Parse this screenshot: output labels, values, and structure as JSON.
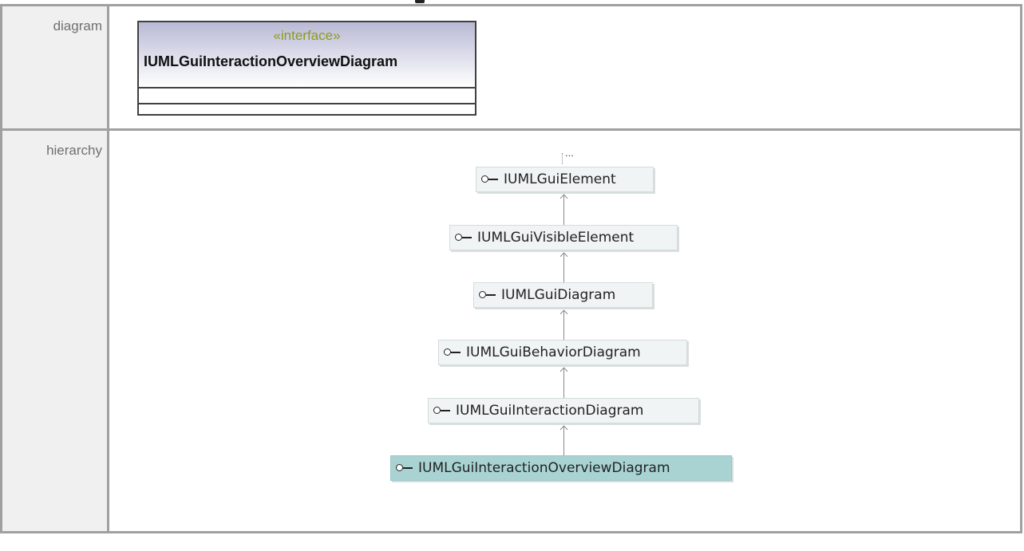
{
  "rows": {
    "diagram_label": "diagram",
    "hierarchy_label": "hierarchy"
  },
  "uml_class": {
    "stereotype": "«interface»",
    "name": "IUMLGuiInteractionOverviewDiagram"
  },
  "hierarchy": {
    "ellipsis": "...",
    "nodes": [
      {
        "label": "IUMLGuiElement",
        "icon": "interface-lollipop-icon"
      },
      {
        "label": "IUMLGuiVisibleElement",
        "icon": "interface-lollipop-icon"
      },
      {
        "label": "IUMLGuiDiagram",
        "icon": "interface-lollipop-icon"
      },
      {
        "label": "IUMLGuiBehaviorDiagram",
        "icon": "interface-lollipop-icon"
      },
      {
        "label": "IUMLGuiInteractionDiagram",
        "icon": "interface-lollipop-icon"
      },
      {
        "label": "IUMLGuiInteractionOverviewDiagram",
        "icon": "interface-lollipop-icon",
        "selected": true
      }
    ]
  },
  "colors": {
    "stereotype": "#8c9b1f",
    "node_bg": "#f0f4f4",
    "node_selected_bg": "#a9d3d3",
    "label_cell_bg": "#f0f0f0",
    "border": "#a0a0a0"
  }
}
